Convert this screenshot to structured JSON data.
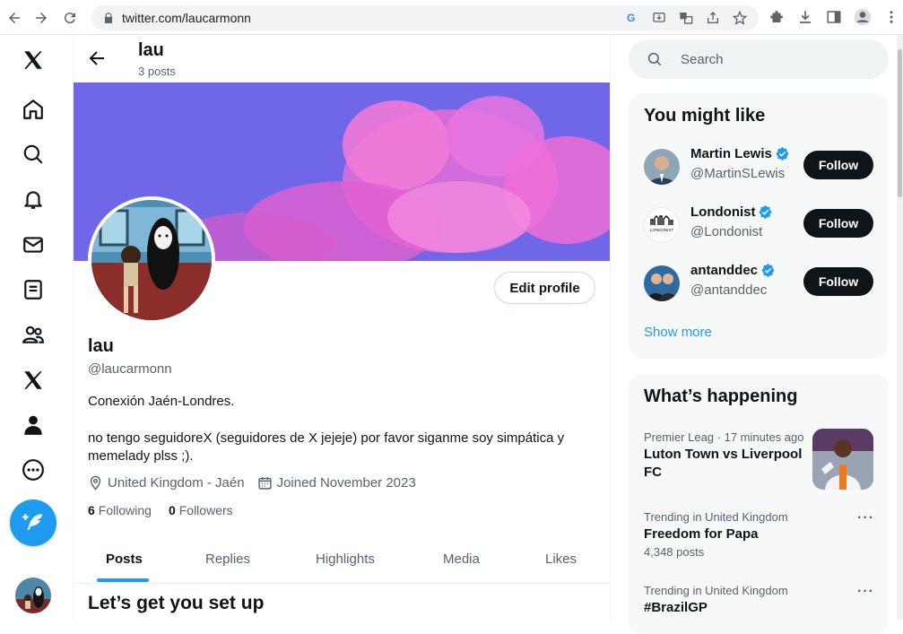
{
  "browser": {
    "url": "twitter.com/laucarmonn"
  },
  "header": {
    "name": "lau",
    "post_count": "3 posts"
  },
  "profile": {
    "name": "lau",
    "handle": "@laucarmonn",
    "edit_label": "Edit profile",
    "bio_line1": "Conexión Jaén-Londres.",
    "bio_line2": "no tengo seguidoreX (seguidores de X jejeje) por favor siganme soy simpática y memelady plss ;).",
    "location": "United Kingdom - Jaén",
    "joined": "Joined November 2023",
    "following_count": "6",
    "following_label": "Following",
    "followers_count": "0",
    "followers_label": "Followers"
  },
  "tabs": [
    "Posts",
    "Replies",
    "Highlights",
    "Media",
    "Likes"
  ],
  "setup_title": "Let’s get you set up",
  "search": {
    "placeholder": "Search"
  },
  "you_might_like": {
    "title": "You might like",
    "accounts": [
      {
        "name": "Martin Lewis",
        "handle": "@MartinSLewis",
        "button": "Follow"
      },
      {
        "name": "Londonist",
        "handle": "@Londonist",
        "button": "Follow"
      },
      {
        "name": "antanddec",
        "handle": "@antanddec",
        "button": "Follow"
      }
    ],
    "show_more": "Show more",
    "londonist_logo_text": "LONDONIST"
  },
  "whats_happening": {
    "title": "What’s happening",
    "trends": [
      {
        "context": "Premier Leag · 17 minutes ago",
        "title": "Luton Town vs Liverpool FC",
        "count": ""
      },
      {
        "context": "Trending in United Kingdom",
        "title": "Freedom for Papa",
        "count": "4,348 posts"
      },
      {
        "context": "Trending in United Kingdom",
        "title": "#BrazilGP",
        "count": ""
      }
    ]
  },
  "colors": {
    "accent": "#1d9bf0",
    "banner": "#6f64e6",
    "follow_button": "#0f1419"
  }
}
